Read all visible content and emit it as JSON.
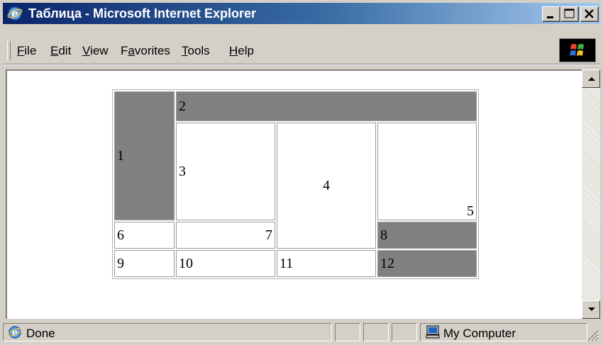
{
  "window": {
    "title": "Таблица - Microsoft Internet Explorer"
  },
  "menu": {
    "items": [
      {
        "pre": "",
        "key": "F",
        "post": "ile"
      },
      {
        "pre": "",
        "key": "E",
        "post": "dit"
      },
      {
        "pre": "",
        "key": "V",
        "post": "iew"
      },
      {
        "pre": "F",
        "key": "a",
        "post": "vorites"
      },
      {
        "pre": "",
        "key": "T",
        "post": "ools"
      },
      {
        "pre": "",
        "key": "H",
        "post": "elp"
      }
    ]
  },
  "table": {
    "cells": [
      "1",
      "2",
      "3",
      "4",
      "5",
      "6",
      "7",
      "8",
      "9",
      "10",
      "11",
      "12"
    ],
    "colors": {
      "gray": "#808080",
      "white": "#ffffff"
    }
  },
  "status": {
    "text": "Done",
    "zone": "My Computer"
  },
  "colors": {
    "titlebar_start": "#0a246a",
    "titlebar_end": "#a6caf0",
    "chrome": "#d4d0c8"
  },
  "icons": {
    "title": "ie-logo-icon",
    "throbber": "windows-logo-icon",
    "status": "ie-page-icon",
    "zone": "computer-icon"
  }
}
